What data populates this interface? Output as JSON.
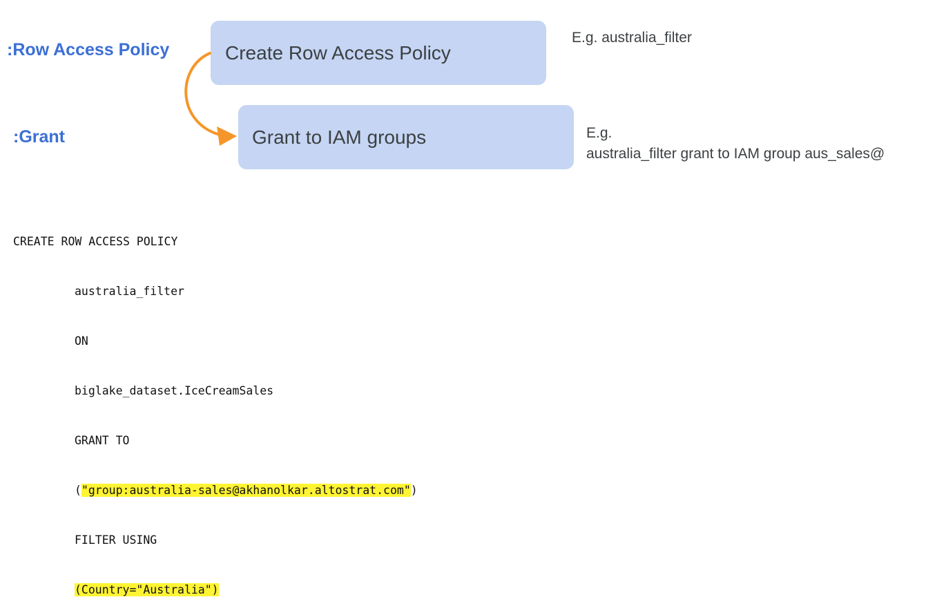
{
  "labels": {
    "row_access_policy": ":Row Access Policy",
    "grant": ":Grant"
  },
  "boxes": {
    "create": "Create Row Access Policy",
    "grant": "Grant to IAM groups"
  },
  "notes": {
    "create_example": "E.g. australia_filter",
    "grant_example_prefix": "E.g.",
    "grant_example_detail": "australia_filter grant to IAM group aus_sales@"
  },
  "code": {
    "line1": "CREATE ROW ACCESS POLICY",
    "line2": "australia_filter",
    "line3": "ON",
    "line4": "biglake_dataset.IceCreamSales",
    "line5": "GRANT TO",
    "line6_open": "(",
    "line6_highlight": "\"group:australia-sales@akhanolkar.altostrat.com\"",
    "line6_close": ")",
    "line7": "FILTER USING",
    "line8_highlight": "(Country=\"Australia\")"
  },
  "colors": {
    "label_blue": "#3b6fd4",
    "box_fill": "#c5d5f3",
    "arrow_orange": "#f5962a",
    "highlight_yellow": "#fff433"
  }
}
